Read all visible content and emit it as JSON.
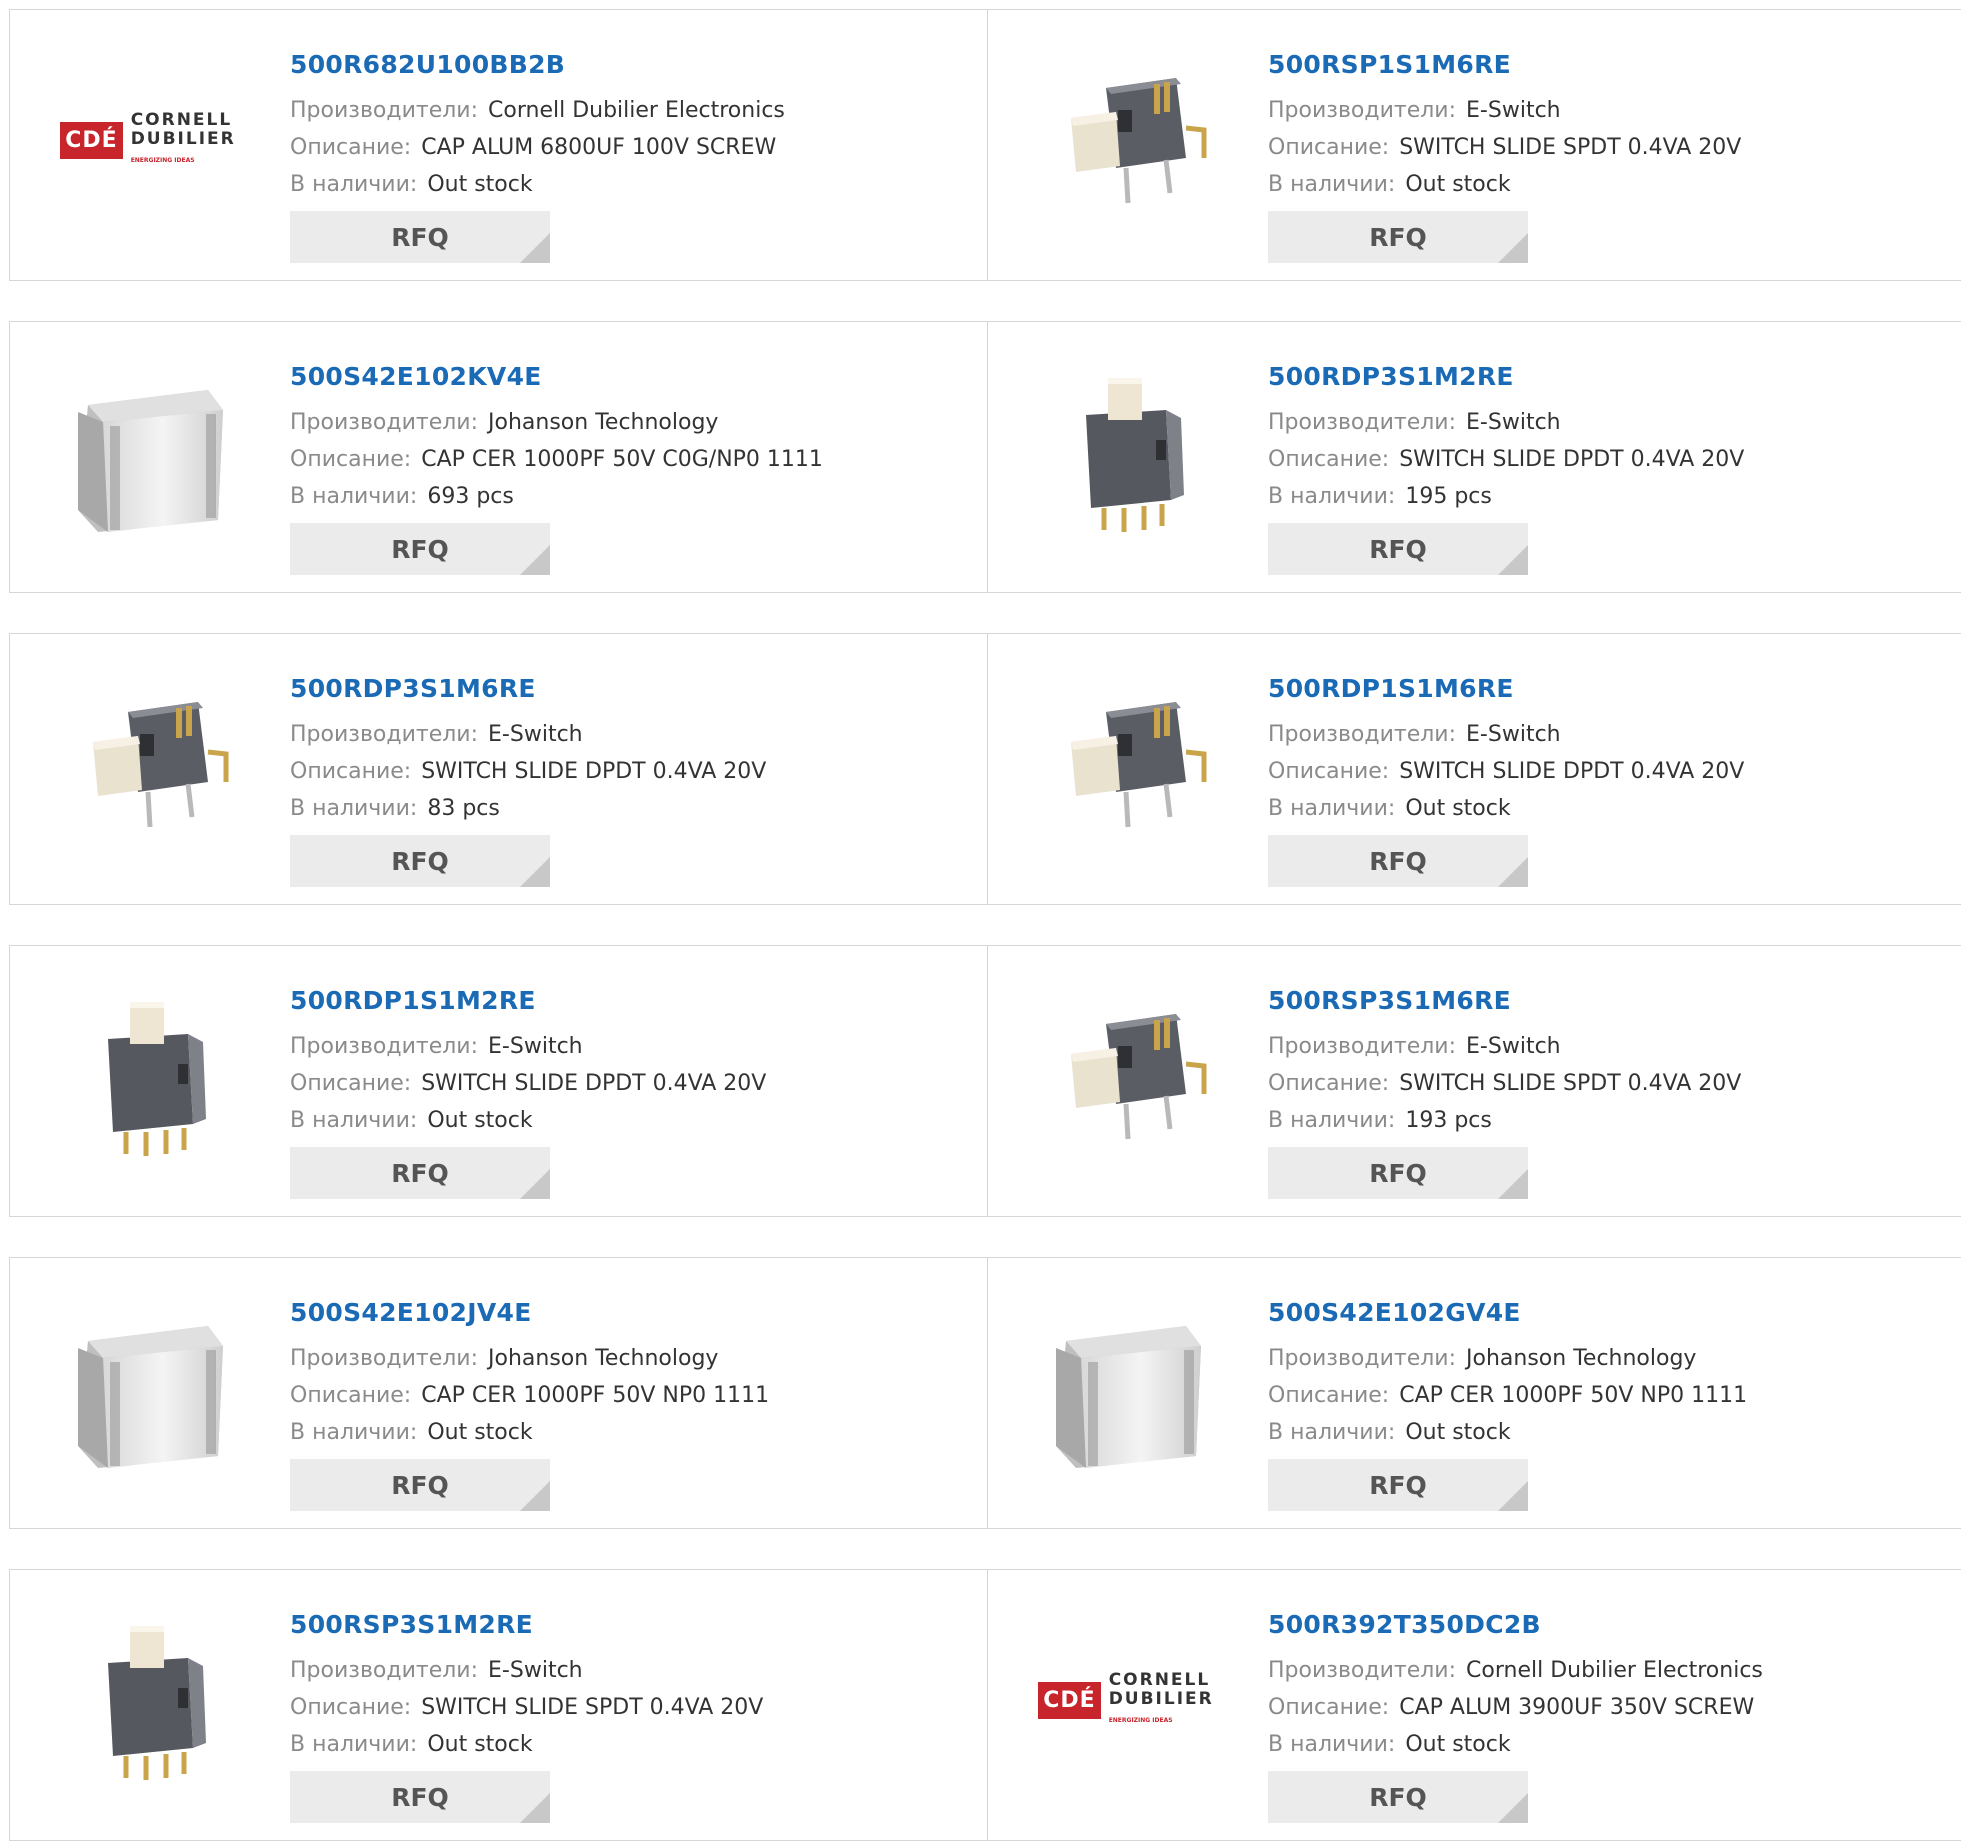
{
  "labels": {
    "manufacturer": "Производители:",
    "description": "Описание:",
    "stock": "В наличии:",
    "rfq": "RFQ"
  },
  "products": [
    {
      "part": "500R682U100BB2B",
      "manufacturer": "Cornell Dubilier Electronics",
      "description": "CAP ALUM 6800UF 100V SCREW",
      "stock": "Out stock",
      "image": "cde-logo"
    },
    {
      "part": "500RSP1S1M6RE",
      "manufacturer": "E-Switch",
      "description": "SWITCH SLIDE SPDT 0.4VA 20V",
      "stock": "Out stock",
      "image": "switch-right-angle"
    },
    {
      "part": "500S42E102KV4E",
      "manufacturer": "Johanson Technology",
      "description": "CAP CER 1000PF 50V C0G/NP0 1111",
      "stock": "693 pcs",
      "image": "ceramic-cube"
    },
    {
      "part": "500RDP3S1M2RE",
      "manufacturer": "E-Switch",
      "description": "SWITCH SLIDE DPDT 0.4VA 20V",
      "stock": "195 pcs",
      "image": "switch-vertical"
    },
    {
      "part": "500RDP3S1M6RE",
      "manufacturer": "E-Switch",
      "description": "SWITCH SLIDE DPDT 0.4VA 20V",
      "stock": "83 pcs",
      "image": "switch-right-angle"
    },
    {
      "part": "500RDP1S1M6RE",
      "manufacturer": "E-Switch",
      "description": "SWITCH SLIDE DPDT 0.4VA 20V",
      "stock": "Out stock",
      "image": "switch-right-angle"
    },
    {
      "part": "500RDP1S1M2RE",
      "manufacturer": "E-Switch",
      "description": "SWITCH SLIDE DPDT 0.4VA 20V",
      "stock": "Out stock",
      "image": "switch-vertical"
    },
    {
      "part": "500RSP3S1M6RE",
      "manufacturer": "E-Switch",
      "description": "SWITCH SLIDE SPDT 0.4VA 20V",
      "stock": "193 pcs",
      "image": "switch-right-angle"
    },
    {
      "part": "500S42E102JV4E",
      "manufacturer": "Johanson Technology",
      "description": "CAP CER 1000PF 50V NP0 1111",
      "stock": "Out stock",
      "image": "ceramic-cube"
    },
    {
      "part": "500S42E102GV4E",
      "manufacturer": "Johanson Technology",
      "description": "CAP CER 1000PF 50V NP0 1111",
      "stock": "Out stock",
      "image": "ceramic-cube"
    },
    {
      "part": "500RSP3S1M2RE",
      "manufacturer": "E-Switch",
      "description": "SWITCH SLIDE SPDT 0.4VA 20V",
      "stock": "Out stock",
      "image": "switch-vertical"
    },
    {
      "part": "500R392T350DC2B",
      "manufacturer": "Cornell Dubilier Electronics",
      "description": "CAP ALUM 3900UF 350V SCREW",
      "stock": "Out stock",
      "image": "cde-logo"
    }
  ],
  "logo": {
    "mark": "CDÉ",
    "line1": "CORNELL",
    "line2": "DUBILIER",
    "tagline": "ENERGIZING IDEAS"
  },
  "colors": {
    "part_link": "#1a6ab5",
    "label": "#8a8a8a",
    "rfq_bg": "#ebebeb",
    "brand_red": "#c8242c"
  }
}
